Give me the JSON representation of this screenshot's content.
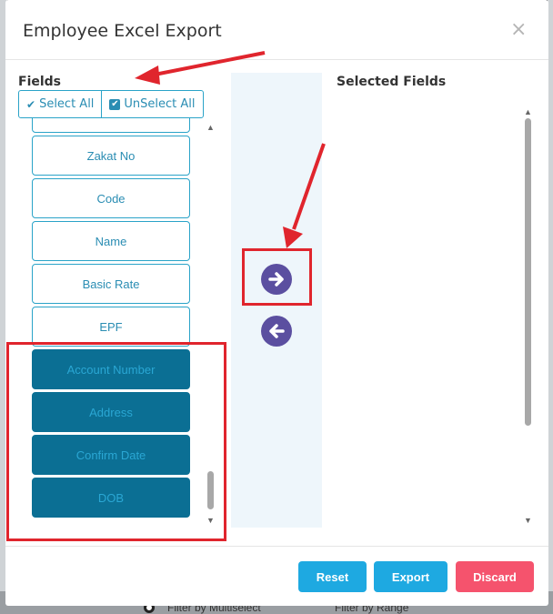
{
  "dialog": {
    "title": "Employee Excel Export",
    "close_icon": "×"
  },
  "left_panel": {
    "label": "Fields",
    "select_all": "Select All",
    "unselect_all": "UnSelect All",
    "items": [
      {
        "label": "Zakat No",
        "selected": false
      },
      {
        "label": "Code",
        "selected": false
      },
      {
        "label": "Name",
        "selected": false
      },
      {
        "label": "Basic Rate",
        "selected": false
      },
      {
        "label": "EPF",
        "selected": false
      },
      {
        "label": "Account Number",
        "selected": true
      },
      {
        "label": "Address",
        "selected": true
      },
      {
        "label": "Confirm Date",
        "selected": true
      },
      {
        "label": "DOB",
        "selected": true
      }
    ]
  },
  "right_panel": {
    "label": "Selected Fields"
  },
  "footer": {
    "reset": "Reset",
    "export": "Export",
    "discard": "Discard"
  },
  "background": {
    "left_text": "Filter by Multiselect",
    "right_text": "Filter by Range"
  },
  "colors": {
    "accent": "#2aa3c8",
    "selected_item": "#0b6f94",
    "arrow_button": "#5b4fa0",
    "reset_button": "#1ea9e1",
    "discard_button": "#f5536d",
    "annotation": "#e0252d"
  }
}
